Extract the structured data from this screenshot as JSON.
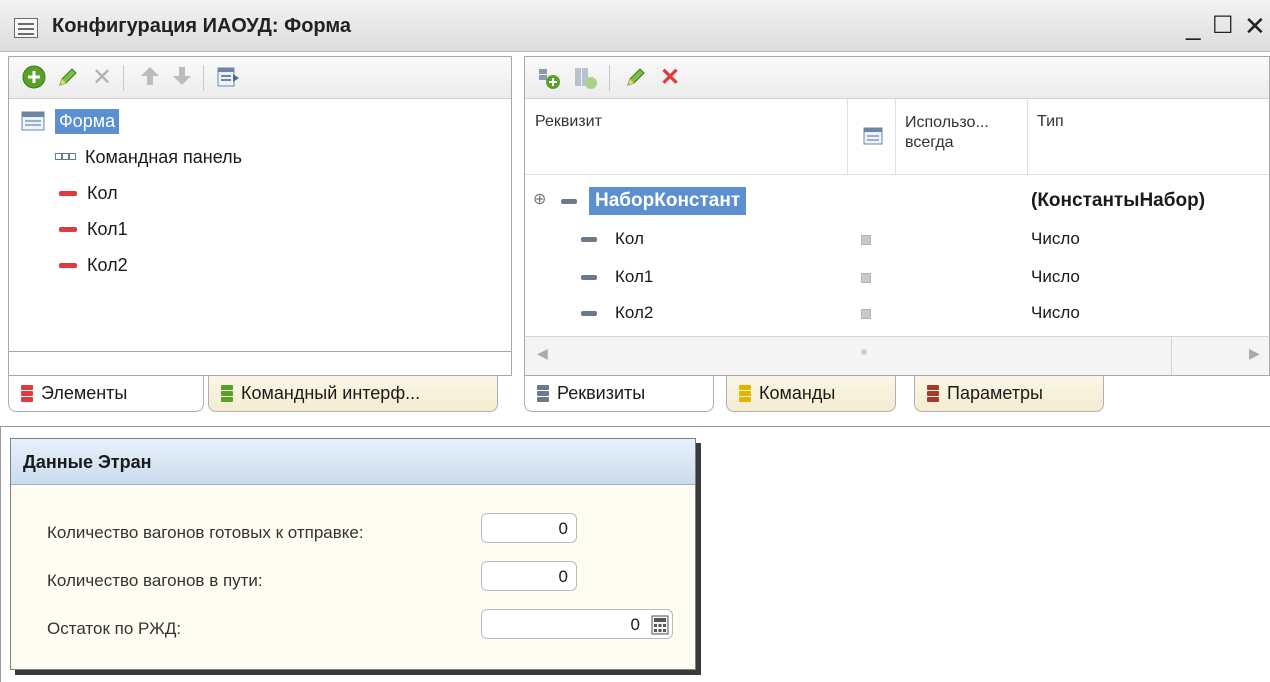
{
  "window": {
    "title": "Конфигурация ИАОУД: Форма",
    "minimize": "_",
    "maximize": "☐",
    "close": "✕"
  },
  "left_panel": {
    "tree": {
      "root": "Форма",
      "items": [
        "Командная панель",
        "Кол",
        "Кол1",
        "Кол2"
      ]
    },
    "tabs": [
      "Элементы",
      "Командный интерф..."
    ]
  },
  "right_panel": {
    "columns": {
      "attr": "Реквизит",
      "use_always": "Использо... всегда",
      "type": "Тип"
    },
    "rows": [
      {
        "name": "НаборКонстант",
        "type": "(КонстантыНабор)"
      },
      {
        "name": "Кол",
        "type": "Число"
      },
      {
        "name": "Кол1",
        "type": "Число"
      },
      {
        "name": "Кол2",
        "type": "Число"
      }
    ],
    "tabs": [
      "Реквизиты",
      "Команды",
      "Параметры"
    ]
  },
  "form": {
    "title": "Данные Этран",
    "fields": [
      {
        "label": "Количество вагонов готовых к отправке:",
        "value": "0"
      },
      {
        "label": "Количество вагонов в пути:",
        "value": "0"
      },
      {
        "label": "Остаток по РЖД:",
        "value": "0"
      }
    ]
  },
  "colors": {
    "selection": "#5b8fd0",
    "red": "#e0393e",
    "green": "#5aa12c",
    "yellow": "#e5b300",
    "dark_red": "#a33a2a"
  }
}
